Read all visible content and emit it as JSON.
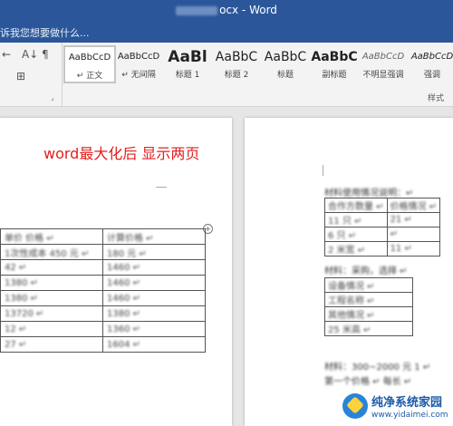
{
  "window": {
    "title": "★本材料.docx - Word",
    "title_suffix": "ocx - Word"
  },
  "tell_me": {
    "text": "诉我您想要做什么..."
  },
  "ribbon": {
    "paragraph_icons": [
      "←",
      "A↓",
      "¶",
      "⊞"
    ],
    "styles": [
      {
        "preview": "AaBbCcD",
        "name": "↵ 正文",
        "selected": true
      },
      {
        "preview": "AaBbCcD",
        "name": "↵ 无间隔",
        "selected": false
      },
      {
        "preview": "AaBl",
        "name": "标题 1",
        "selected": false
      },
      {
        "preview": "AaBbC",
        "name": "标题 2",
        "selected": false
      },
      {
        "preview": "AaBbC",
        "name": "标题",
        "selected": false
      },
      {
        "preview": "AaBbC",
        "name": "副标题",
        "selected": false
      },
      {
        "preview": "AaBbCcD",
        "name": "不明显强调",
        "selected": false
      },
      {
        "preview": "AaBbCcD",
        "name": "强调",
        "selected": false
      }
    ],
    "group_label": "样式"
  },
  "annotation": "word最大化后 显示两页",
  "page1_table": {
    "rows": [
      [
        "单价 价格 ↵",
        "计算价格 ↵"
      ],
      [
        "1次性成本 450 元 ↵",
        "180 元 ↵"
      ],
      [
        "42 ↵",
        "1460 ↵"
      ],
      [
        "1380 ↵",
        "1460 ↵"
      ],
      [
        "1380 ↵",
        "1460 ↵"
      ],
      [
        "13720 ↵",
        "1380 ↵"
      ],
      [
        "12 ↵",
        "1360 ↵"
      ],
      [
        "27 ↵",
        "1604 ↵"
      ]
    ]
  },
  "page2": {
    "heading": "材料使用情况说明：↵",
    "table_a": [
      [
        "合作方数量 ↵",
        "价格情况 ↵"
      ],
      [
        "11 只 ↵",
        "21 ↵"
      ],
      [
        "6 只 ↵",
        "↵"
      ],
      [
        "2 米宽 ↵",
        "11 ↵"
      ]
    ],
    "line2": "材料：采购，选择 ↵",
    "table_b": [
      "设备情况 ↵",
      "工程名称 ↵",
      "其他情况 ↵",
      "25 米高 ↵"
    ],
    "line3": "材料：300~2000 元 1 ↵",
    "line4": "第一个价格 ↵  每长 ↵"
  },
  "watermark": {
    "name": "纯净系统家园",
    "url": "www.yidaimei.com"
  }
}
